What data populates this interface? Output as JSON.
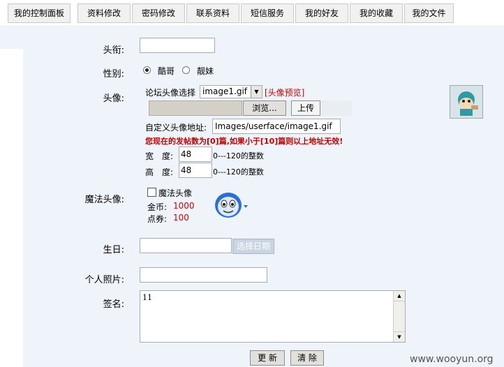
{
  "tabs": [
    "我的控制面板",
    "资料修改",
    "密码修改",
    "联系资料",
    "短信服务",
    "我的好友",
    "我的收藏",
    "我的文件"
  ],
  "form": {
    "title_label": "头衔:",
    "title_value": "",
    "gender_label": "性别:",
    "gender_options": [
      "酷哥",
      "靓妹"
    ],
    "gender_selected": "酷哥",
    "avatar_label": "头像:",
    "forum_avatar_label": "论坛头像选择",
    "avatar_select_value": "image1.gif",
    "avatar_preview_link": "[头像预览]",
    "browse_button": "浏览...",
    "upload_button": "上传",
    "custom_avatar_label": "自定义头像地址:",
    "custom_avatar_value": "Images/userface/image1.gif",
    "post_count_warning": "您现在的发帖数为[0]篇,如果小于[10]篇则以上地址无效!",
    "width_label": "宽　度:",
    "width_value": "48",
    "width_hint": "0---120的整数",
    "height_label": "高　度:",
    "height_value": "48",
    "height_hint": "0---120的整数",
    "magic_avatar_label": "魔法头像:",
    "magic_avatar_checkbox": "魔法头像",
    "gold_label": "金币:",
    "gold_value": "1000",
    "points_label": "点券:",
    "points_value": "100",
    "birthday_label": "生日:",
    "birthday_value": "",
    "select_date_button": "选择日期",
    "photo_label": "个人照片:",
    "photo_value": "",
    "signature_label": "签名:",
    "signature_value": "11",
    "update_button": "更 新",
    "clear_button": "清 除"
  },
  "watermark": "www.wooyun.org"
}
